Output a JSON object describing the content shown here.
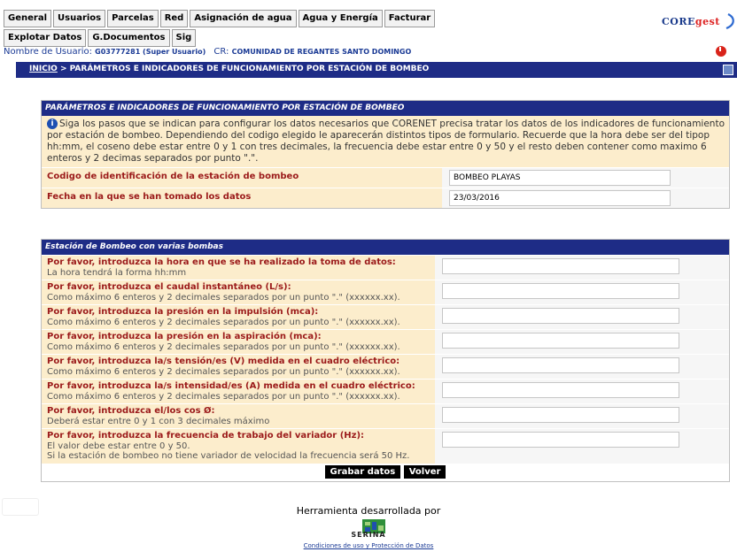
{
  "nav": {
    "row1": [
      "General",
      "Usuarios",
      "Parcelas",
      "Red",
      "Asignación de agua",
      "Agua y Energía",
      "Facturar"
    ],
    "row2": [
      "Explotar Datos",
      "G.Documentos",
      "Sig"
    ]
  },
  "brand": {
    "logo_text_part1": "CORE",
    "logo_text_part2": "gest"
  },
  "user": {
    "label": "Nombre de Usuario:",
    "value": "G03777281 (Super Usuario)",
    "cr_label": "CR:",
    "cr_value": "COMUNIDAD DE REGANTES SANTO DOMINGO"
  },
  "breadcrumb": {
    "home": "INICIO",
    "separator": " > ",
    "current": "PARÁMETROS E INDICADORES DE FUNCIONAMIENTO POR ESTACIÓN DE BOMBEO"
  },
  "panel1": {
    "title": "PARÁMETROS E INDICADORES DE FUNCIONAMIENTO POR ESTACIÓN DE BOMBEO",
    "info": "Siga los pasos que se indican para configurar los datos necesarios que CORENET precisa tratar los datos de los indicadores de funcionamiento por estación de bombeo. Dependiendo del codigo elegido le aparecerán distintos tipos de formulario. Recuerde que la hora debe ser del tipop hh:mm, el coseno debe estar entre 0 y 1 con tres decimales, la frecuencia debe estar entre 0 y 50 y el resto deben contener como maximo 6 enteros y 2 decimas separados por punto \".\".",
    "code_label": "Codigo de identificación de la estación de bombeo",
    "code_value": "BOMBEO PLAYAS",
    "date_label": "Fecha en la que se han tomado los datos",
    "date_value": "23/03/2016"
  },
  "panel2": {
    "title": "Estación de Bombeo con varias bombas",
    "questions": [
      {
        "h": "Por favor, introduzca la hora en que se ha realizado la toma de datos:",
        "s": "La hora tendrá la forma hh:mm"
      },
      {
        "h": "Por favor, introduzca el caudal instantáneo (L/s):",
        "s": "Como máximo 6 enteros y 2 decimales separados por un punto \".\" (xxxxxx.xx)."
      },
      {
        "h": "Por favor, introduzca la presión en la impulsión (mca):",
        "s": "Como máximo 6 enteros y 2 decimales separados por un punto \".\" (xxxxxx.xx)."
      },
      {
        "h": "Por favor, introduzca la presión en la aspiración (mca):",
        "s": "Como máximo 6 enteros y 2 decimales separados por un punto \".\" (xxxxxx.xx)."
      },
      {
        "h": "Por favor, introduzca la/s tensión/es (V) medida en el cuadro eléctrico:",
        "s": "Como máximo 6 enteros y 2 decimales separados por un punto \".\" (xxxxxx.xx)."
      },
      {
        "h": "Por favor, introduzca la/s intensidad/es (A) medida en el cuadro eléctrico:",
        "s": "Como máximo 6 enteros y 2 decimales separados por un punto \".\" (xxxxxx.xx)."
      },
      {
        "h": "Por favor, introduzca el/los cos Ø:",
        "s": "Deberá estar entre 0 y 1 con 3 decimales máximo"
      },
      {
        "h": "Por favor, introduzca la frecuencia de trabajo del variador (Hz):",
        "s": "El valor debe estar entre 0 y 50.",
        "s2": "Si la estación de bombeo no tiene variador de velocidad la frecuencia será 50 Hz."
      }
    ],
    "save_label": "Grabar datos",
    "back_label": "Volver"
  },
  "footer": {
    "developed_by": "Herramienta desarrollada por",
    "company": "SERINA",
    "conditions": "Condiciones de uso y Protección de Datos"
  },
  "colors": {
    "navy": "#1e2c86",
    "beige": "#fcedcc",
    "label_red": "#9b1a1a",
    "link_blue": "#1a3a95"
  }
}
